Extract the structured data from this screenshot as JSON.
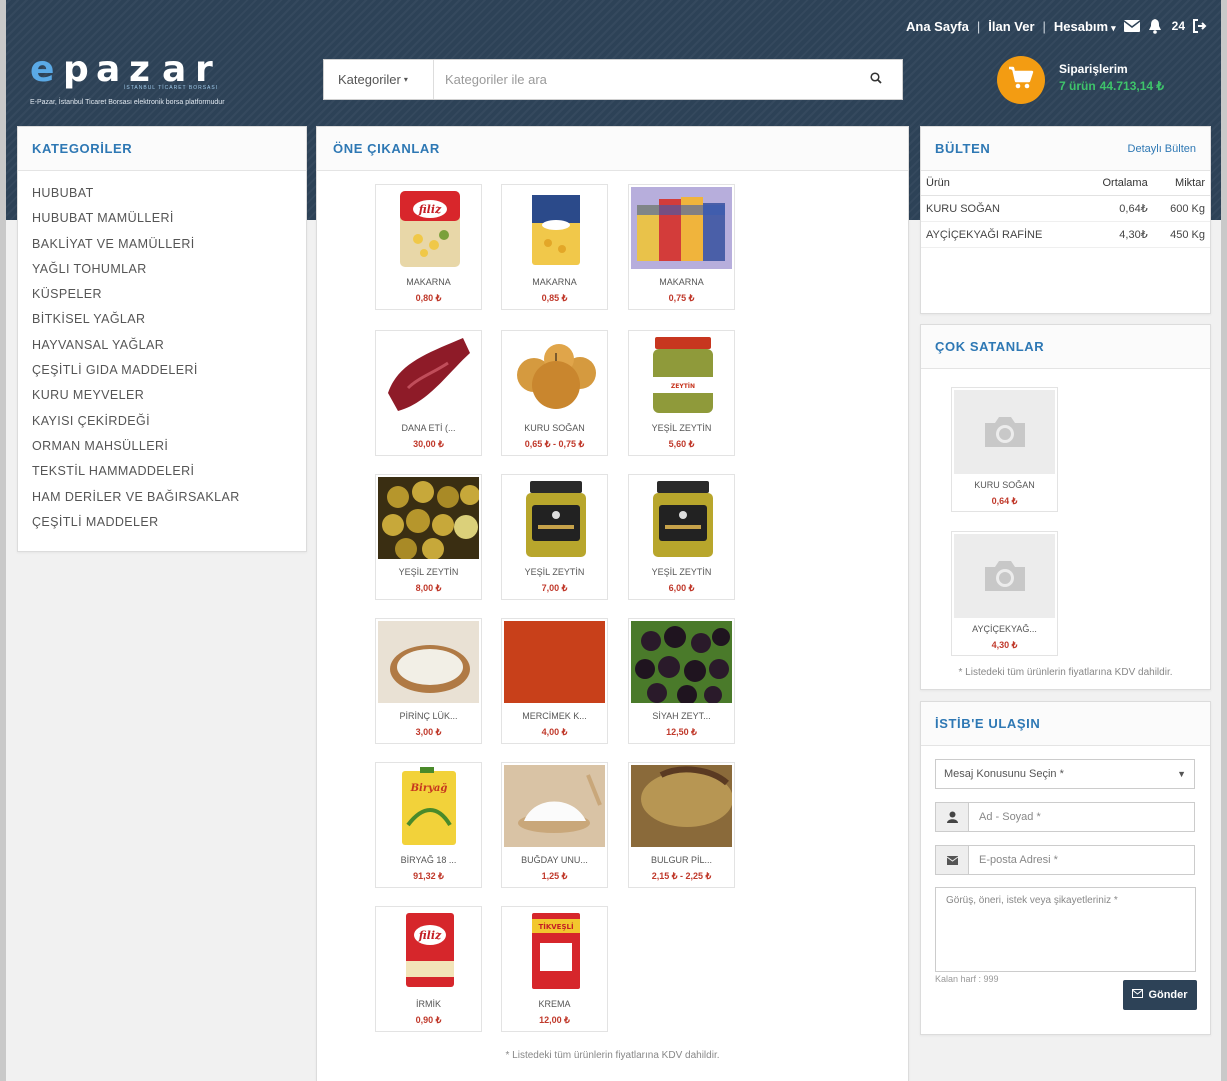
{
  "nav": {
    "home": "Ana Sayfa",
    "post_ad": "İlan Ver",
    "account": "Hesabım",
    "notification_count": "24"
  },
  "logo": {
    "letters": [
      "e",
      "p",
      "a",
      "z",
      "a",
      "r"
    ],
    "subtitle": "İSTANBUL TİCARET BORSASI",
    "tagline": "E-Pazar, İstanbul Ticaret Borsası elektronik borsa platformudur"
  },
  "search": {
    "category_label": "Kategoriler",
    "placeholder": "Kategoriler ile ara"
  },
  "cart": {
    "title": "Siparişlerim",
    "count": "7 ürün",
    "total": "44.713,14 ₺"
  },
  "categories": {
    "title": "KATEGORİLER",
    "items": [
      "HUBUBAT",
      "HUBUBAT MAMÜLLERİ",
      "BAKLİYAT VE MAMÜLLERİ",
      "YAĞLI TOHUMLAR",
      "KÜSPELER",
      "BİTKİSEL YAĞLAR",
      "HAYVANSAL YAĞLAR",
      "ÇEŞİTLİ GIDA MADDELERİ",
      "KURU MEYVELER",
      "KAYISI ÇEKİRDEĞİ",
      "ORMAN MAHSÜLLERİ",
      "TEKSTİL HAMMADDELERİ",
      "HAM DERİLER VE BAĞIRSAKLAR",
      "ÇEŞİTLİ MADDELER"
    ]
  },
  "featured": {
    "title": "ÖNE ÇIKANLAR",
    "products": [
      {
        "name": "MAKARNA",
        "price": "0,80 ₺",
        "kind": "filiz-pasta"
      },
      {
        "name": "MAKARNA",
        "price": "0,85 ₺",
        "kind": "pasta-bag"
      },
      {
        "name": "MAKARNA",
        "price": "0,75 ₺",
        "kind": "pasta-multi"
      },
      {
        "name": "DANA ETİ (...",
        "price": "30,00 ₺",
        "kind": "beef"
      },
      {
        "name": "KURU SOĞAN",
        "price": "0,65 ₺ - 0,75 ₺",
        "kind": "onion"
      },
      {
        "name": "YEŞİL ZEYTİN",
        "price": "5,60 ₺",
        "kind": "olive-jar"
      },
      {
        "name": "YEŞİL ZEYTİN",
        "price": "8,00 ₺",
        "kind": "green-olives"
      },
      {
        "name": "YEŞİL ZEYTİN",
        "price": "7,00 ₺",
        "kind": "olive-jar-dark"
      },
      {
        "name": "YEŞİL ZEYTİN",
        "price": "6,00 ₺",
        "kind": "olive-jar-dark"
      },
      {
        "name": "PİRİNÇ LÜK...",
        "price": "3,00 ₺",
        "kind": "rice"
      },
      {
        "name": "MERCİMEK K...",
        "price": "4,00 ₺",
        "kind": "lentil"
      },
      {
        "name": "SİYAH ZEYT...",
        "price": "12,50 ₺",
        "kind": "black-olives"
      },
      {
        "name": "BİRYAĞ 18 ...",
        "price": "91,32 ₺",
        "kind": "oil-can"
      },
      {
        "name": "BUĞDAY UNU...",
        "price": "1,25 ₺",
        "kind": "flour"
      },
      {
        "name": "BULGUR PİL...",
        "price": "2,15 ₺ - 2,25 ₺",
        "kind": "bulgur"
      },
      {
        "name": "İRMİK",
        "price": "0,90 ₺",
        "kind": "semolina"
      },
      {
        "name": "KREMA",
        "price": "12,00 ₺",
        "kind": "cream"
      }
    ],
    "note": "* Listedeki tüm ürünlerin fiyatlarına KDV dahildir."
  },
  "bulletin": {
    "title": "BÜLTEN",
    "link": "Detaylı Bülten",
    "columns": [
      "Ürün",
      "Ortalama",
      "Miktar"
    ],
    "rows": [
      [
        "KURU SOĞAN",
        "0,64₺",
        "600 Kg"
      ],
      [
        "AYÇİÇEKYAĞI RAFİNE",
        "4,30₺",
        "450 Kg"
      ]
    ]
  },
  "best_sellers": {
    "title": "ÇOK SATANLAR",
    "items": [
      {
        "name": "KURU SOĞAN",
        "price": "0,64 ₺"
      },
      {
        "name": "AYÇİÇEKYAĞ...",
        "price": "4,30 ₺"
      }
    ],
    "note": "* Listedeki tüm ürünlerin fiyatlarına KDV dahildir."
  },
  "contact": {
    "title": "İSTİB'E ULAŞIN",
    "subject_placeholder": "Mesaj Konusunu Seçin *",
    "name_placeholder": "Ad - Soyad *",
    "email_placeholder": "E-posta Adresi *",
    "message_placeholder": "Görüş, öneri, istek veya şikayetleriniz *",
    "remaining": "Kalan harf : 999",
    "send_label": "Gönder"
  },
  "colors": {
    "header": "#2d4257",
    "accent": "#2e78b4",
    "price": "#c0392b",
    "cart": "#f39c12",
    "cart_total": "#3ec46a"
  }
}
